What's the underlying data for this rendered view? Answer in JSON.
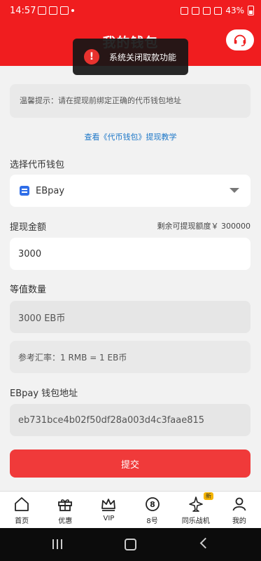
{
  "status_bar": {
    "time": "14:57",
    "battery": "43%"
  },
  "header": {
    "title": "我的钱包"
  },
  "toast": {
    "icon": "!",
    "message": "系统关闭取款功能"
  },
  "tip": {
    "text": "温馨提示：请在提现前绑定正确的代币钱包地址"
  },
  "tutorial_link": "查看《代币钱包》提现教学",
  "wallet": {
    "label": "选择代币钱包",
    "selected": "EBpay"
  },
  "amount": {
    "label": "提现金额",
    "quota": "剩余可提现额度￥ 300000",
    "value": "3000"
  },
  "equivalent": {
    "label": "等值数量",
    "value": "3000 EB币"
  },
  "rate": {
    "text": "参考汇率：1 RMB = 1 EB币"
  },
  "address": {
    "label": "EBpay 钱包地址",
    "value": "eb731bce4b02f50df28a003d4c3faae815"
  },
  "submit_label": "提交",
  "tabs": [
    {
      "label": "首页",
      "icon": "home-icon"
    },
    {
      "label": "优惠",
      "icon": "gift-icon"
    },
    {
      "label": "VIP",
      "icon": "crown-icon"
    },
    {
      "label": "8号",
      "icon": "eight-ball-icon"
    },
    {
      "label": "同乐战机",
      "icon": "fighter-jet-icon",
      "badge": "新"
    },
    {
      "label": "我的",
      "icon": "user-icon"
    }
  ],
  "colors": {
    "brand_red": "#f01d1f",
    "submit_red": "#f03a3a",
    "link_blue": "#1e78c8"
  }
}
